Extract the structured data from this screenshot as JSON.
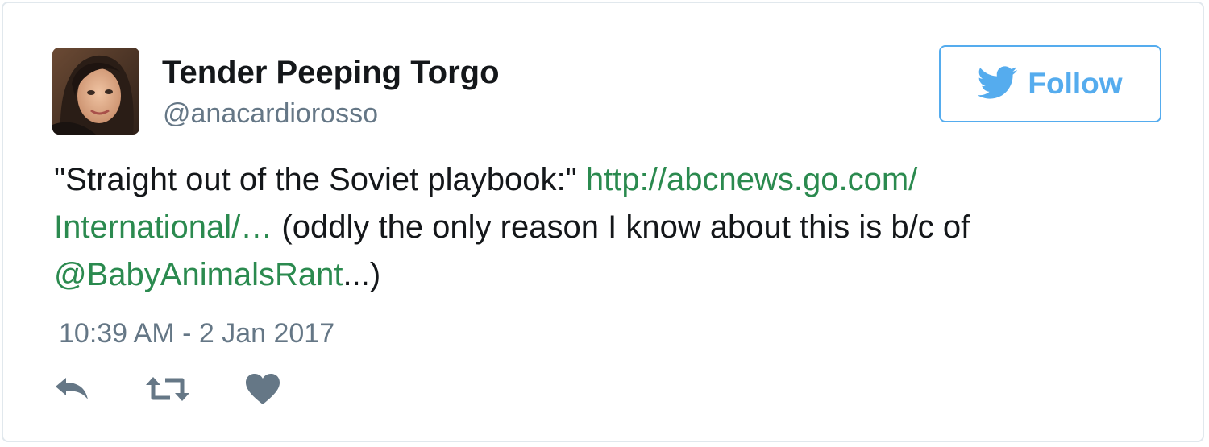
{
  "user": {
    "display_name": "Tender Peeping Torgo",
    "handle": "@anacardiorosso"
  },
  "follow_button": {
    "label": "Follow"
  },
  "tweet": {
    "quote": "\"Straight out of the Soviet playbook:\"",
    "link_part1": "http://abcnews.go.com/",
    "link_part2": "International/…",
    "text_after_link": "(oddly the only reason I know about this is b/c of",
    "mention": "@BabyAnimalsRant",
    "text_end": "...)"
  },
  "timestamp": "10:39 AM - 2 Jan 2017",
  "actions": [
    "reply-icon",
    "retweet-icon",
    "like-icon"
  ],
  "colors": {
    "accent": "#55acee",
    "link": "#2b8a4f",
    "secondary_text": "#657786",
    "icon": "#657786",
    "border": "#e1e8ed"
  }
}
